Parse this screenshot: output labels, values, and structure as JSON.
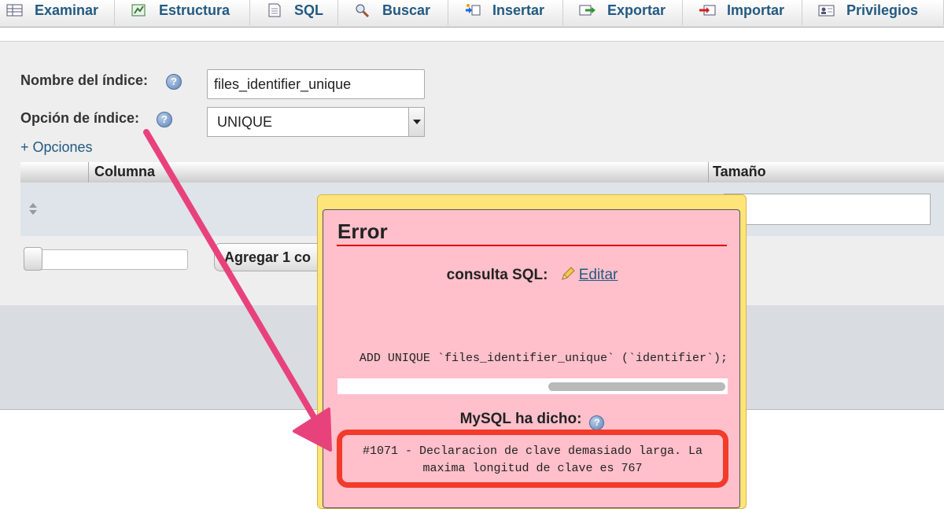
{
  "tabs": [
    {
      "label": "Examinar",
      "icon": "browse-icon"
    },
    {
      "label": "Estructura",
      "icon": "structure-icon"
    },
    {
      "label": "SQL",
      "icon": "sql-icon"
    },
    {
      "label": "Buscar",
      "icon": "search-icon"
    },
    {
      "label": "Insertar",
      "icon": "insert-icon"
    },
    {
      "label": "Exportar",
      "icon": "export-icon"
    },
    {
      "label": "Importar",
      "icon": "import-icon"
    },
    {
      "label": "Privilegios",
      "icon": "privileges-icon"
    }
  ],
  "form": {
    "index_name_label": "Nombre del índice:",
    "index_name_value": "files_identifier_unique",
    "index_option_label": "Opción de índice:",
    "index_option_value": "UNIQUE",
    "more_options_link": "+ Opciones",
    "columns_header": {
      "column": "Columna",
      "size": "Tamaño"
    },
    "add_button_label": "Agregar 1 co"
  },
  "error_dialog": {
    "title": "Error",
    "sql_query_label": "consulta SQL:",
    "edit_link": "Editar",
    "sql_query_text": "ADD UNIQUE `files_identifier_unique` (`identifier`);",
    "mysql_said_label": "MySQL ha dicho:",
    "error_message_line1": "#1071 - Declaracion de clave demasiado larga. La",
    "error_message_line2": "maxima longitud de clave es 767"
  },
  "colors": {
    "link": "#235a81",
    "error_bg": "#ffc0cb",
    "dialog_frame": "#fde57a",
    "highlight": "#f23b2a",
    "arrow": "#e8427c"
  }
}
